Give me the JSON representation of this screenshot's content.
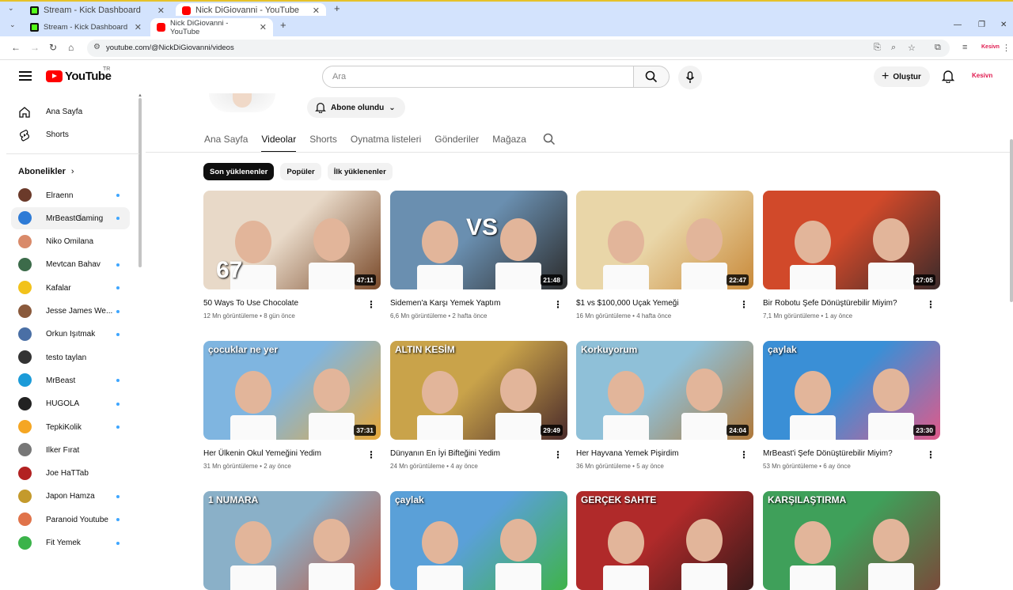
{
  "outer_tabs": [
    {
      "title": "Stream - Kick Dashboard"
    },
    {
      "title": "Nick DiGiovanni - YouTube"
    }
  ],
  "browser": {
    "tabs": [
      {
        "title": "Stream - Kick Dashboard",
        "favicon": "kick-icon"
      },
      {
        "title": "Nick DiGiovanni - YouTube",
        "favicon": "youtube-icon"
      }
    ],
    "url": "youtube.com/@NickDiGiovanni/videos"
  },
  "header": {
    "logo_word": "YouTube",
    "logo_country": "TR",
    "search_placeholder": "Ara",
    "create_label": "Oluştur",
    "avatar_text": "Kesivn"
  },
  "sidebar": {
    "nav": [
      {
        "label": "Ana Sayfa",
        "icon": "home-icon"
      },
      {
        "label": "Shorts",
        "icon": "shorts-icon"
      }
    ],
    "subscriptions_heading": "Abonelikler",
    "subscriptions": [
      {
        "label": "Elraenn",
        "dot": true,
        "color": "#6b3a2a"
      },
      {
        "label": "MrBeastGaming",
        "dot": true,
        "color": "#2e7bd6"
      },
      {
        "label": "Niko Omilana",
        "dot": false,
        "color": "#d98a6a"
      },
      {
        "label": "Mevtcan Bahav",
        "dot": true,
        "color": "#3c6b4a"
      },
      {
        "label": "Kafalar",
        "dot": true,
        "color": "#f2c21b"
      },
      {
        "label": "Jesse James We...",
        "dot": true,
        "color": "#8a5a3c"
      },
      {
        "label": "Orkun Işıtmak",
        "dot": true,
        "color": "#4a6fa5"
      },
      {
        "label": "testo taylan",
        "dot": false,
        "color": "#333333"
      },
      {
        "label": "MrBeast",
        "dot": true,
        "color": "#1c9bd8"
      },
      {
        "label": "HUGOLA",
        "dot": true,
        "color": "#222222"
      },
      {
        "label": "TepkiKolik",
        "dot": true,
        "color": "#f5a623"
      },
      {
        "label": "İlker Fırat",
        "dot": false,
        "color": "#777777"
      },
      {
        "label": "Joe HaTTab",
        "dot": false,
        "color": "#b22222"
      },
      {
        "label": "Japon Hamza",
        "dot": true,
        "color": "#c49a2c"
      },
      {
        "label": "Paranoid Youtube",
        "dot": true,
        "color": "#e0734a"
      },
      {
        "label": "Fit Yemek",
        "dot": true,
        "color": "#3bb34a"
      }
    ]
  },
  "channel": {
    "subscribe_label": "Abone olundu",
    "tabs": [
      "Ana Sayfa",
      "Videolar",
      "Shorts",
      "Oynatma listeleri",
      "Gönderiler",
      "Mağaza"
    ],
    "active_tab": "Videolar",
    "chips": [
      "Son yüklenenler",
      "Popüler",
      "İlk yüklenenler"
    ]
  },
  "videos": [
    {
      "title": "50 Ways To Use Chocolate",
      "views": "12 Mn görüntüleme",
      "age": "8 gün önce",
      "duration": "47:11",
      "overlay": "67",
      "c1": "#e8d9c8",
      "c2": "#7a4a2a"
    },
    {
      "title": "Sidemen'a Karşı Yemek Yaptım",
      "views": "6,6 Mn görüntüleme",
      "age": "2 hafta önce",
      "duration": "21:48",
      "overlay": "VS",
      "c1": "#6a8fb0",
      "c2": "#2b2b2b"
    },
    {
      "title": "$1 vs $100,000 Uçak Yemeği",
      "views": "16 Mn görüntüleme",
      "age": "4 hafta önce",
      "duration": "22:47",
      "overlay": "",
      "c1": "#e9d6a8",
      "c2": "#c98a3a"
    },
    {
      "title": "Bir Robotu Şefe Dönüştürebilir Miyim?",
      "views": "7,1 Mn görüntüleme",
      "age": "1 ay önce",
      "duration": "27:05",
      "overlay": "",
      "c1": "#d1492a",
      "c2": "#3a2a2a"
    },
    {
      "title": "Her Ülkenin Okul Yemeğini Yedim",
      "views": "31 Mn görüntüleme",
      "age": "2 ay önce",
      "duration": "37:31",
      "overlay": "çocuklar ne yer",
      "c1": "#7fb5e0",
      "c2": "#e8a93a"
    },
    {
      "title": "Dünyanın En İyi Bifteğini Yedim",
      "views": "24 Mn görüntüleme",
      "age": "4 ay önce",
      "duration": "29:49",
      "overlay": "ALTIN KESİM",
      "c1": "#c9a34a",
      "c2": "#4a2a2a"
    },
    {
      "title": "Her Hayvana Yemek Pişirdim",
      "views": "36 Mn görüntüleme",
      "age": "5 ay önce",
      "duration": "24:04",
      "overlay": "Korkuyorum",
      "c1": "#8fc0d8",
      "c2": "#b0793a"
    },
    {
      "title": "MrBeast'i Şefe Dönüştürebilir Miyim?",
      "views": "53 Mn görüntüleme",
      "age": "6 ay önce",
      "duration": "23:30",
      "overlay": "çaylak",
      "c1": "#3a8fd6",
      "c2": "#e05a8a"
    },
    {
      "title": "",
      "views": "",
      "age": "",
      "duration": "",
      "overlay": "1 NUMARA",
      "c1": "#8ab0c8",
      "c2": "#c0523a"
    },
    {
      "title": "",
      "views": "",
      "age": "",
      "duration": "",
      "overlay": "çaylak",
      "c1": "#5aa0d8",
      "c2": "#3fb34a"
    },
    {
      "title": "",
      "views": "",
      "age": "",
      "duration": "",
      "overlay": "GERÇEK   SAHTE",
      "c1": "#b02a2a",
      "c2": "#3a1a1a"
    },
    {
      "title": "",
      "views": "",
      "age": "",
      "duration": "",
      "overlay": "KARŞILAŞTIRMA",
      "c1": "#3fa05a",
      "c2": "#7a4a3a"
    }
  ]
}
